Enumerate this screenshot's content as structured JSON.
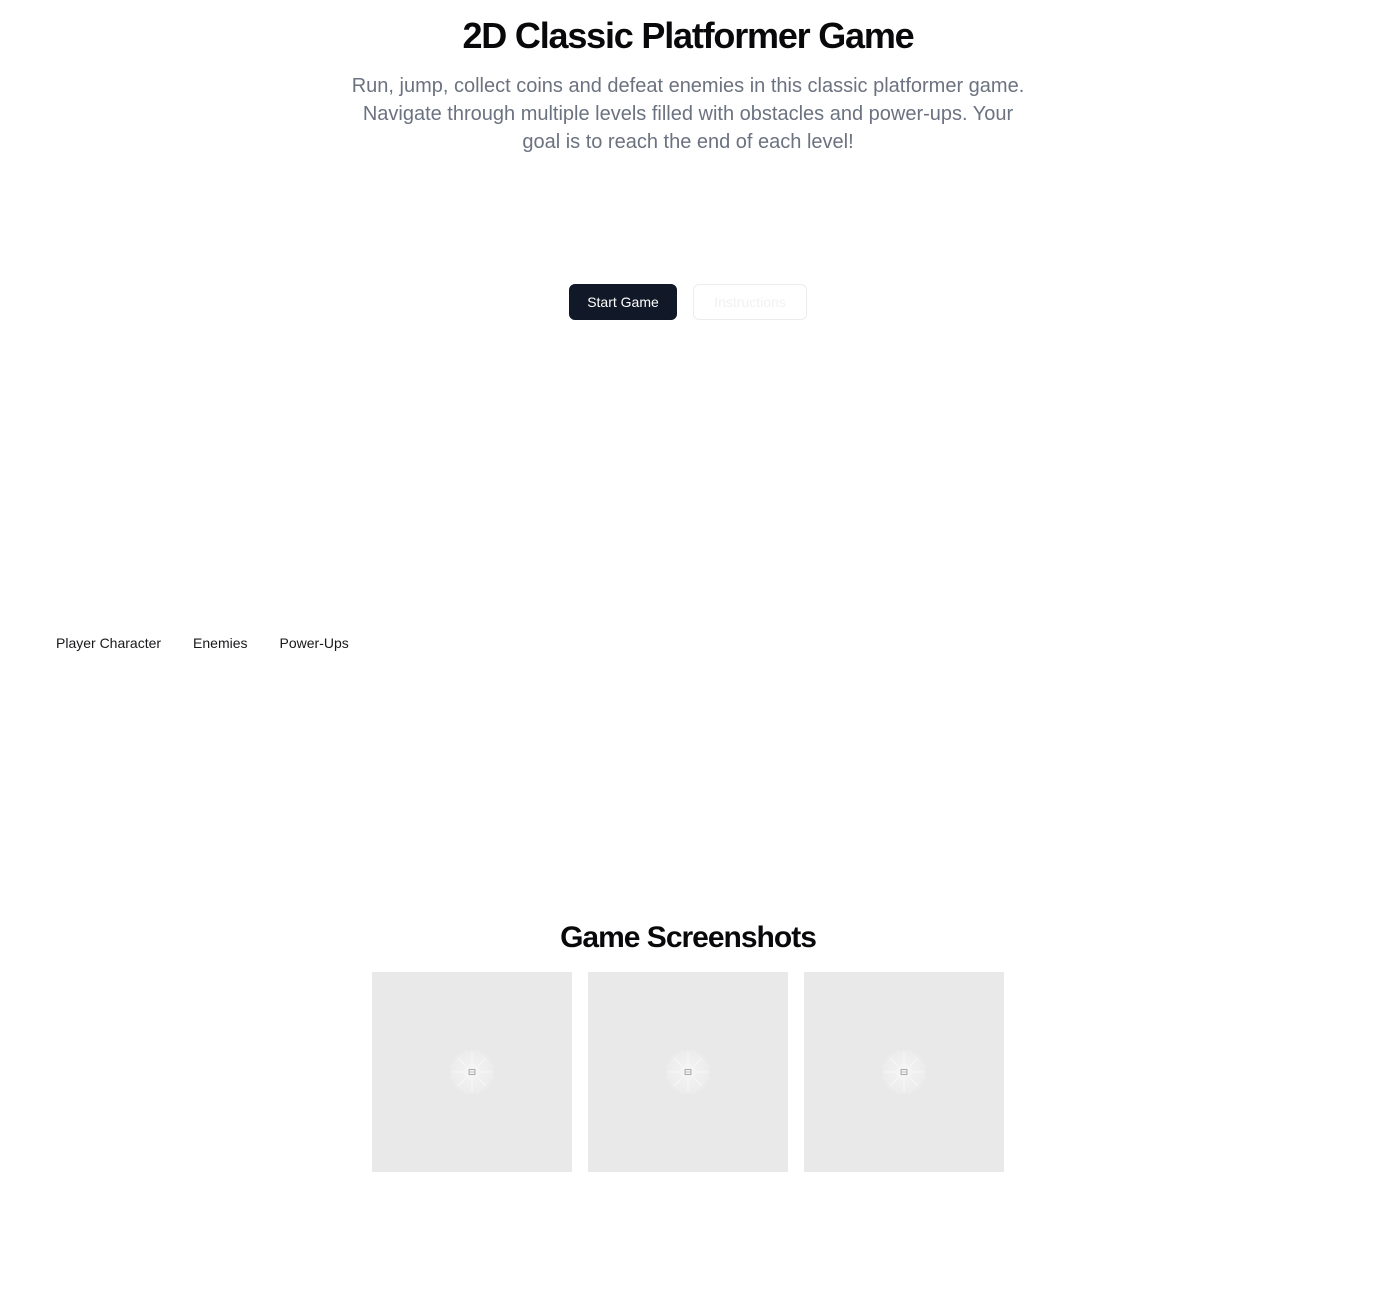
{
  "hero": {
    "title": "2D Classic Platformer Game",
    "description": "Run, jump, collect coins and defeat enemies in this classic platformer game. Navigate through multiple levels filled with obstacles and power-ups. Your goal is to reach the end of each level!"
  },
  "actions": {
    "start_label": "Start Game",
    "instructions_label": "Instructions"
  },
  "tabs": [
    {
      "label": "Player Character"
    },
    {
      "label": "Enemies"
    },
    {
      "label": "Power-Ups"
    }
  ],
  "screenshots": {
    "title": "Game Screenshots",
    "items": [
      {
        "icon": "image-placeholder-icon"
      },
      {
        "icon": "image-placeholder-icon"
      },
      {
        "icon": "image-placeholder-icon"
      }
    ]
  },
  "colors": {
    "primary_button": "#111827",
    "muted_text": "#6b7280",
    "placeholder_bg": "#e9e9e9"
  }
}
